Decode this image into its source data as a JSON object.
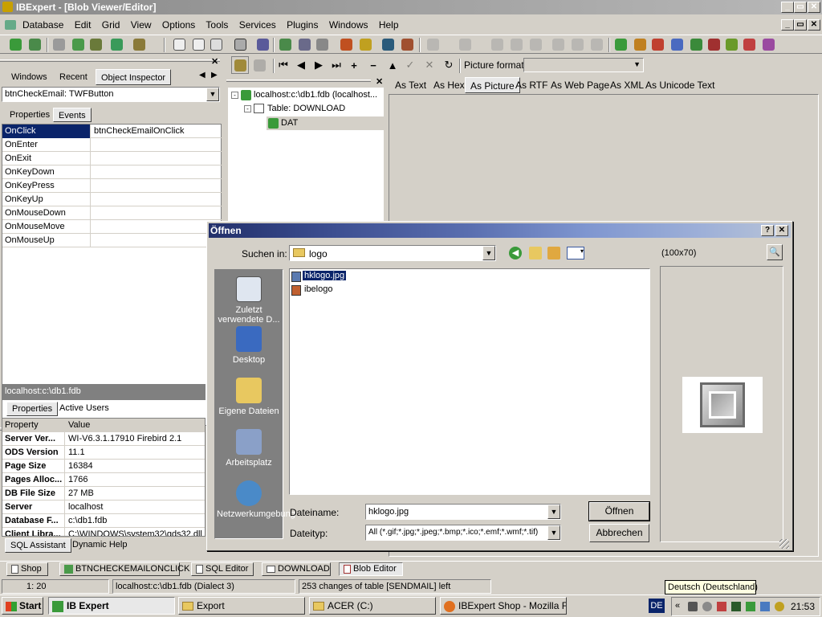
{
  "app": {
    "title": "IBExpert - [Blob Viewer/Editor]",
    "window_controls": [
      "_",
      "▭",
      "✕"
    ],
    "child_controls": [
      "_",
      "▭",
      "✕"
    ]
  },
  "menu": [
    "Database",
    "Edit",
    "Grid",
    "View",
    "Options",
    "Tools",
    "Services",
    "Plugins",
    "Windows",
    "Help"
  ],
  "left_panel": {
    "tabs": [
      "Windows",
      "Recent",
      "Object Inspector"
    ],
    "component": "btnCheckEmail: TWFButton",
    "subtabs": [
      "Properties",
      "Events"
    ],
    "events": [
      {
        "name": "OnClick",
        "value": "btnCheckEmailOnClick"
      },
      {
        "name": "OnEnter",
        "value": ""
      },
      {
        "name": "OnExit",
        "value": ""
      },
      {
        "name": "OnKeyDown",
        "value": ""
      },
      {
        "name": "OnKeyPress",
        "value": ""
      },
      {
        "name": "OnKeyUp",
        "value": ""
      },
      {
        "name": "OnMouseDown",
        "value": ""
      },
      {
        "name": "OnMouseMove",
        "value": ""
      },
      {
        "name": "OnMouseUp",
        "value": ""
      }
    ]
  },
  "db_panel": {
    "title": "localhost:c:\\db1.fdb",
    "tabs": [
      "Properties",
      "Active Users"
    ],
    "header": {
      "k": "Property",
      "v": "Value"
    },
    "rows": [
      {
        "k": "Server Ver...",
        "v": "WI-V6.3.1.17910 Firebird 2.1"
      },
      {
        "k": "ODS Version",
        "v": "11.1"
      },
      {
        "k": "Page Size",
        "v": "16384"
      },
      {
        "k": "Pages Alloc...",
        "v": "1766"
      },
      {
        "k": "DB File Size",
        "v": "27 MB"
      },
      {
        "k": "Server",
        "v": "localhost"
      },
      {
        "k": "Database F...",
        "v": "c:\\db1.fdb"
      },
      {
        "k": "Client Libra...",
        "v": "C:\\WINDOWS\\system32\\gds32.dll"
      }
    ],
    "bottom_tabs": [
      "SQL Assistant",
      "Dynamic Help"
    ]
  },
  "tree": {
    "items": [
      "localhost:c:\\db1.fdb (localhost...",
      "Table: DOWNLOAD",
      "DAT"
    ]
  },
  "blob": {
    "picture_format_label": "Picture format",
    "tabs": [
      "As Text",
      "As Hex",
      "As Picture",
      "As RTF",
      "As Web Page",
      "As XML",
      "As Unicode Text"
    ]
  },
  "dialog": {
    "title": "Öffnen",
    "help": "?",
    "close": "✕",
    "look_in_label": "Suchen in:",
    "look_in_value": "logo",
    "places": [
      "Zuletzt verwendete D...",
      "Desktop",
      "Eigene Dateien",
      "Arbeitsplatz",
      "Netzwerkumgebung"
    ],
    "files": [
      "hklogo.jpg",
      "ibelogo"
    ],
    "preview_size": "(100x70)",
    "filename_label": "Dateiname:",
    "filename_value": "hklogo.jpg",
    "filetype_label": "Dateityp:",
    "filetype_value": "All (*.gif;*.jpg;*.jpeg;*.bmp;*.ico;*.emf;*.wmf;*.tif)",
    "open_button": "Öffnen",
    "cancel_button": "Abbrechen"
  },
  "windows_bar": [
    "Shop",
    "BTNCHECKEMAILONCLICK",
    "SQL Editor",
    "DOWNLOAD",
    "Blob Editor"
  ],
  "status": {
    "position": "1:  20",
    "connection": "localhost:c:\\db1.fdb (Dialect 3)",
    "message": "253 changes of table [SENDMAIL] left"
  },
  "tooltip": "Deutsch (Deutschland)",
  "taskbar": {
    "start": "Start",
    "items": [
      "IB Expert",
      "Export",
      "ACER (C:)",
      "IBExpert Shop - Mozilla F..."
    ],
    "lang": "DE",
    "clock": "21:53"
  }
}
